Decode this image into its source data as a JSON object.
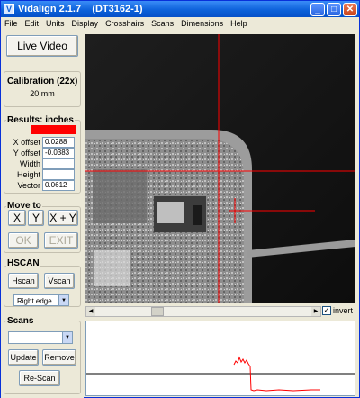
{
  "window": {
    "title": "Vidalign 2.1.7    (DT3162-1)",
    "app_icon": "V",
    "controls": {
      "minimize": "_",
      "maximize": "□",
      "close": "✕"
    }
  },
  "menu": [
    "File",
    "Edit",
    "Units",
    "Display",
    "Crosshairs",
    "Scans",
    "Dimensions",
    "Help"
  ],
  "left": {
    "live_video": "Live Video",
    "calibration_label": "Calibration (22x)",
    "calibration_value": "20 mm",
    "results_label": "Results: inches",
    "fields": [
      {
        "label": "X offset",
        "value": "0.0288"
      },
      {
        "label": "Y offset",
        "value": "-0.0383"
      },
      {
        "label": "Width",
        "value": ""
      },
      {
        "label": "Height",
        "value": ""
      },
      {
        "label": "Vector",
        "value": "0.0612"
      }
    ],
    "result_status_color": "#ff0000",
    "move_to_label": "Move to",
    "move_x": "X",
    "move_y": "Y",
    "move_xy": "X + Y",
    "ok": "OK",
    "exit": "EXIT",
    "hscan_label": "HSCAN",
    "hscan": "Hscan",
    "vscan": "Vscan",
    "edge_select": "Right edge",
    "scans_label": "Scans",
    "scans_select": "",
    "update": "Update",
    "remove": "Remove",
    "rescan": "Re-Scan"
  },
  "video": {
    "invert_label": "invert",
    "invert_checked": "✓",
    "crosshair_color": "#ff0000"
  }
}
